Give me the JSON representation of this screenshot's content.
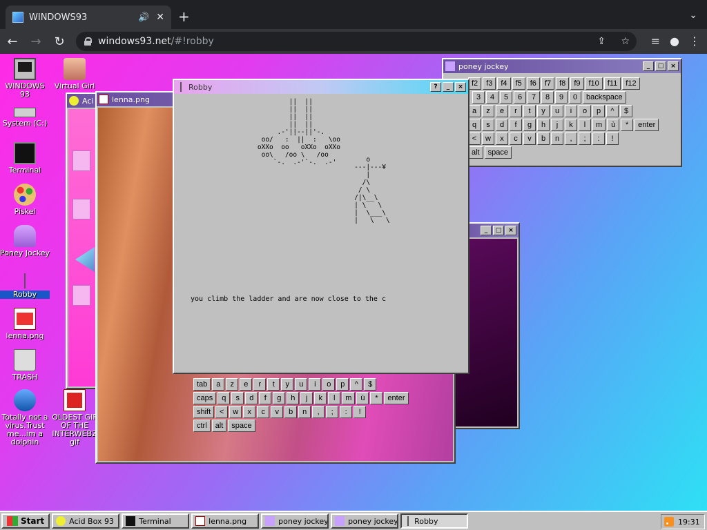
{
  "browser": {
    "tab_title": "WINDOWS93",
    "url_host": "windows93.net",
    "url_path": "/#!robby"
  },
  "desktop_icons": [
    {
      "label": "WINDOWS 93"
    },
    {
      "label": "Virtual Girl"
    },
    {
      "label": "System (C:)"
    },
    {
      "label": "Terminal"
    },
    {
      "label": "Piskel"
    },
    {
      "label": "Poney Jockey"
    },
    {
      "label": "Robby"
    },
    {
      "label": "lenna.png"
    },
    {
      "label": "TRASH"
    },
    {
      "label": "Totally not a virus.Trust me...im a dolphin"
    },
    {
      "label": "OLDEST GIF OF THE INTERWEBZ gif"
    }
  ],
  "windows": {
    "acid_title": "Aci",
    "lenna_title": "lenna.png",
    "robby_title": "Robby",
    "poney_title": "poney jockey"
  },
  "keyboard_top": {
    "row1": [
      "f2",
      "f3",
      "f4",
      "f5",
      "f6",
      "f7",
      "f8",
      "f9",
      "f10",
      "f11",
      "f12"
    ],
    "row2": [
      "3",
      "4",
      "5",
      "6",
      "7",
      "8",
      "9",
      "0",
      "backspace"
    ],
    "row3": [
      "a",
      "z",
      "e",
      "r",
      "t",
      "y",
      "u",
      "i",
      "o",
      "p",
      "^",
      "$"
    ],
    "row4": [
      "q",
      "s",
      "d",
      "f",
      "g",
      "h",
      "j",
      "k",
      "l",
      "m",
      "ù",
      "*",
      "enter"
    ],
    "row5": [
      "<",
      "w",
      "x",
      "c",
      "v",
      "b",
      "n",
      ",",
      ";",
      ":",
      "!"
    ],
    "row6": [
      "alt",
      "space"
    ]
  },
  "keyboard_bottom": {
    "row1": [
      "tab",
      "a",
      "z",
      "e",
      "r",
      "t",
      "y",
      "u",
      "i",
      "o",
      "p",
      "^",
      "$"
    ],
    "row2": [
      "caps",
      "q",
      "s",
      "d",
      "f",
      "g",
      "h",
      "j",
      "k",
      "l",
      "m",
      "ù",
      "*",
      "enter"
    ],
    "row3": [
      "shift",
      "<",
      "w",
      "x",
      "c",
      "v",
      "b",
      "n",
      ",",
      ";",
      ":",
      "!"
    ],
    "row4": [
      "ctrl",
      "alt",
      "space"
    ]
  },
  "robby": {
    "ascii_chandelier": "            ||  ||\n            ||  ||\n            ||  ||\n            ||  ||\n         .-'||--||'-.\n     oo/   :  ||  :   \\oo\n    oXXo  oo   oXXo  oXXo\n     oo\\   /oo \\   /oo\n        `-.  .-'`-.  .-'",
    "ascii_ladder": "      o\n   ---|---¥\n      |\n     /\\\n    / \\\n   /|\\__\\\n   | \\   \\\n   |  \\___\\\n   |   \\   \\",
    "message": "you climb the ladder and are now close to the c"
  },
  "taskbar": {
    "start_label": "Start",
    "items": [
      "Acid Box 93",
      "Terminal",
      "lenna.png",
      "poney jockey",
      "poney jockey",
      "Robby"
    ],
    "clock": "19:31"
  }
}
